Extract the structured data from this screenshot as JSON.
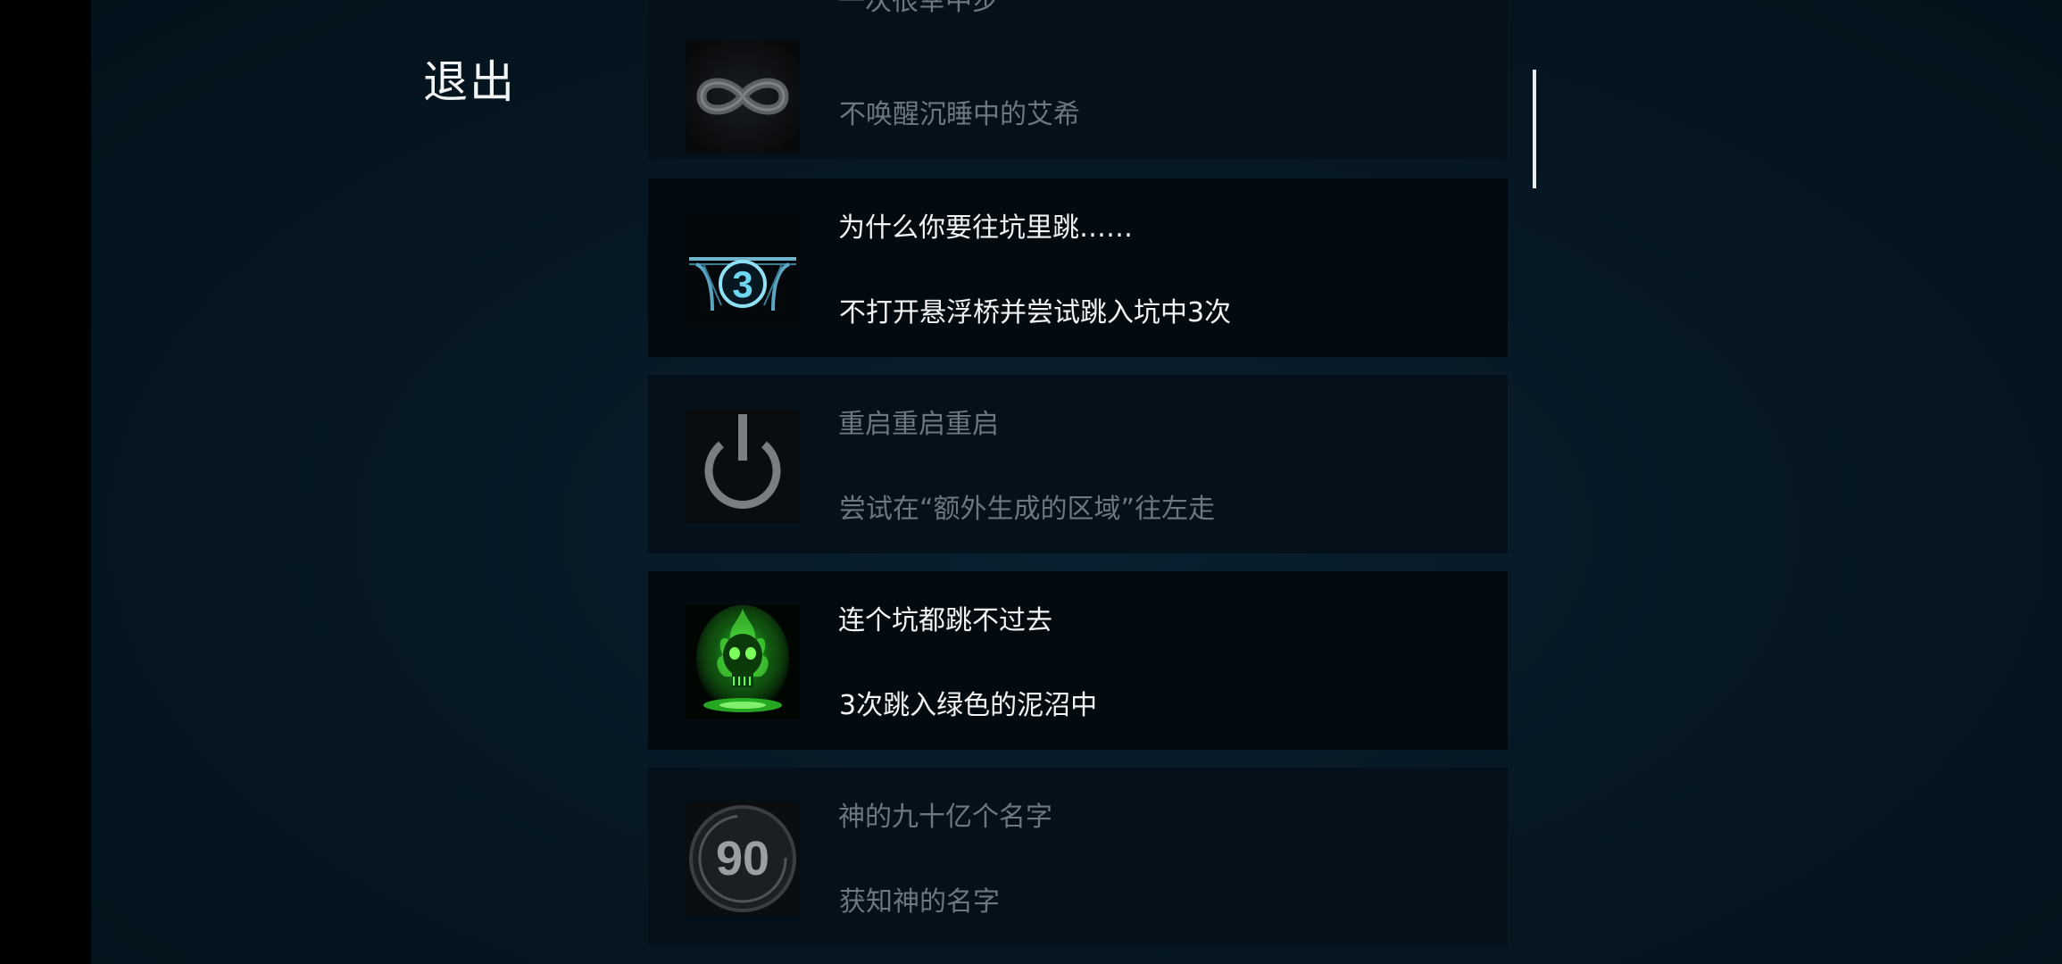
{
  "header": {
    "exit_label": "退出"
  },
  "achievements": [
    {
      "title": "一次很幸中步",
      "description": "不唤醒沉睡中的艾希",
      "icon": "infinity-icon",
      "unlocked": false
    },
    {
      "title": "为什么你要往坑里跳……",
      "description": "不打开悬浮桥并尝试跳入坑中3次",
      "icon": "bridge-three-icon",
      "icon_text": "3",
      "unlocked": true
    },
    {
      "title": "重启重启重启",
      "description": "尝试在“额外生成的区域”往左走",
      "icon": "power-icon",
      "unlocked": false
    },
    {
      "title": "连个坑都跳不过去",
      "description": "3次跳入绿色的泥沼中",
      "icon": "green-skull-icon",
      "unlocked": true
    },
    {
      "title": "神的九十亿个名字",
      "description": "获知神的名字",
      "icon": "ninety-badge-icon",
      "icon_text": "90",
      "unlocked": false
    }
  ],
  "colors": {
    "background": "#061824",
    "card_unlocked": "#040b10",
    "card_locked": "#04101a",
    "text_unlocked": "#f2f4f6",
    "text_locked": "#6c7880",
    "accent_cyan": "#4fc8e8",
    "accent_green": "#3dff3a"
  }
}
